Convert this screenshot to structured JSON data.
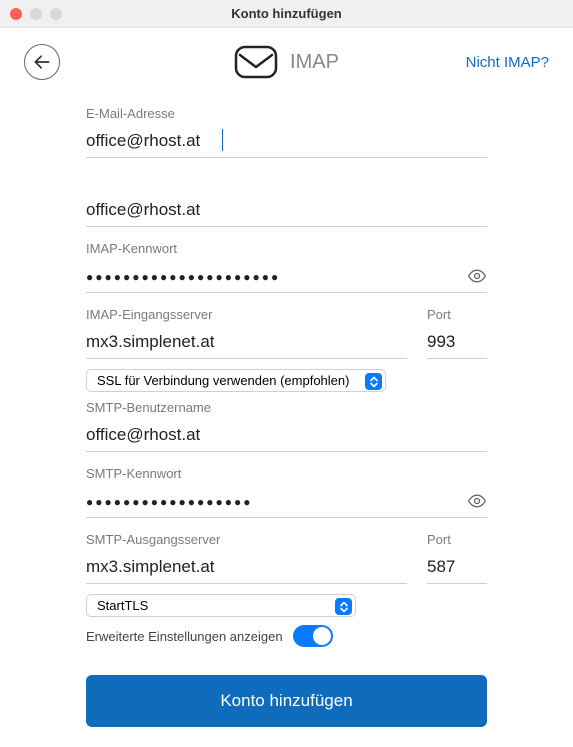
{
  "window": {
    "title": "Konto hinzufügen"
  },
  "header": {
    "protocol": "IMAP",
    "not_imap": "Nicht IMAP?"
  },
  "fields": {
    "email_label": "E-Mail-Adresse",
    "email_value": "office@rhost.at",
    "username_value": "office@rhost.at",
    "imap_pw_label": "IMAP-Kennwort",
    "imap_pw_masked": "●●●●●●●●●●●●●●●●●●●●●",
    "imap_server_label": "IMAP-Eingangsserver",
    "imap_server_value": "mx3.simplenet.at",
    "imap_port_label": "Port",
    "imap_port_value": "993",
    "imap_ssl_option": "SSL für Verbindung verwenden (empfohlen)",
    "smtp_user_label": "SMTP-Benutzername",
    "smtp_user_value": "office@rhost.at",
    "smtp_pw_label": "SMTP-Kennwort",
    "smtp_pw_masked": "●●●●●●●●●●●●●●●●●●",
    "smtp_server_label": "SMTP-Ausgangsserver",
    "smtp_server_value": "mx3.simplenet.at",
    "smtp_port_label": "Port",
    "smtp_port_value": "587",
    "smtp_tls_option": "StartTLS",
    "advanced_label": "Erweiterte Einstellungen anzeigen"
  },
  "submit_label": "Konto hinzufügen"
}
